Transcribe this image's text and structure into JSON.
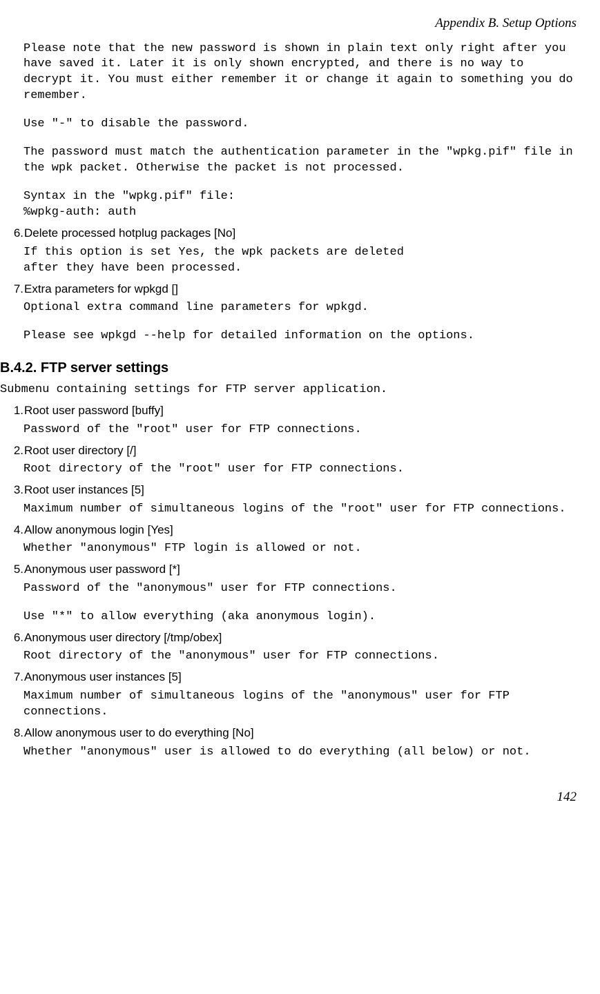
{
  "header": "Appendix B. Setup Options",
  "pre_items": {
    "p1": "Please note that the new password is shown in plain text only right after you have saved it. Later it is only shown encrypted, and there is no way to decrypt it. You must either remember it or change it again to something you do remember.",
    "p2": "Use \"-\" to disable the password.",
    "p3": "The password must match the authentication parameter in the \"wpkg.pif\" file in the wpk packet. Otherwise the packet is not processed.",
    "p4": "Syntax in the \"wpkg.pif\" file:\n%wpkg-auth: auth"
  },
  "item6": {
    "num": "6.",
    "label": "Delete processed hotplug packages [No]",
    "desc": "If this option is set Yes, the wpk packets are deleted\nafter they have been processed."
  },
  "item7": {
    "num": "7.",
    "label": "Extra parameters for wpkgd []",
    "desc1": "Optional extra command line parameters for wpkgd.",
    "desc2": "Please see wpkgd --help for detailed information on the options."
  },
  "section": {
    "heading": "B.4.2. FTP server settings",
    "desc": "Submenu containing settings for FTP server application."
  },
  "ftp": {
    "i1": {
      "num": "1.",
      "label": "Root user password [buffy]",
      "desc": "Password of the \"root\" user for FTP connections."
    },
    "i2": {
      "num": "2.",
      "label": "Root user directory [/]",
      "desc": "Root directory of the \"root\" user for FTP connections."
    },
    "i3": {
      "num": "3.",
      "label": "Root user instances [5]",
      "desc": "Maximum number of simultaneous logins of the \"root\" user for FTP connections."
    },
    "i4": {
      "num": "4.",
      "label": "Allow anonymous login [Yes]",
      "desc": "Whether \"anonymous\" FTP login is allowed or not."
    },
    "i5": {
      "num": "5.",
      "label": "Anonymous user password [*]",
      "desc1": "Password of the \"anonymous\" user for FTP connections.",
      "desc2": "Use \"*\" to allow everything (aka anonymous login)."
    },
    "i6": {
      "num": "6.",
      "label": "Anonymous user directory [/tmp/obex]",
      "desc": "Root directory of the \"anonymous\" user for FTP connections."
    },
    "i7": {
      "num": "7.",
      "label": "Anonymous user instances [5]",
      "desc": "Maximum number of simultaneous logins of the \"anonymous\" user for FTP connections."
    },
    "i8": {
      "num": "8.",
      "label": "Allow anonymous user to do everything [No]",
      "desc": "Whether \"anonymous\" user is allowed to do everything (all below) or not."
    }
  },
  "footer": "142"
}
